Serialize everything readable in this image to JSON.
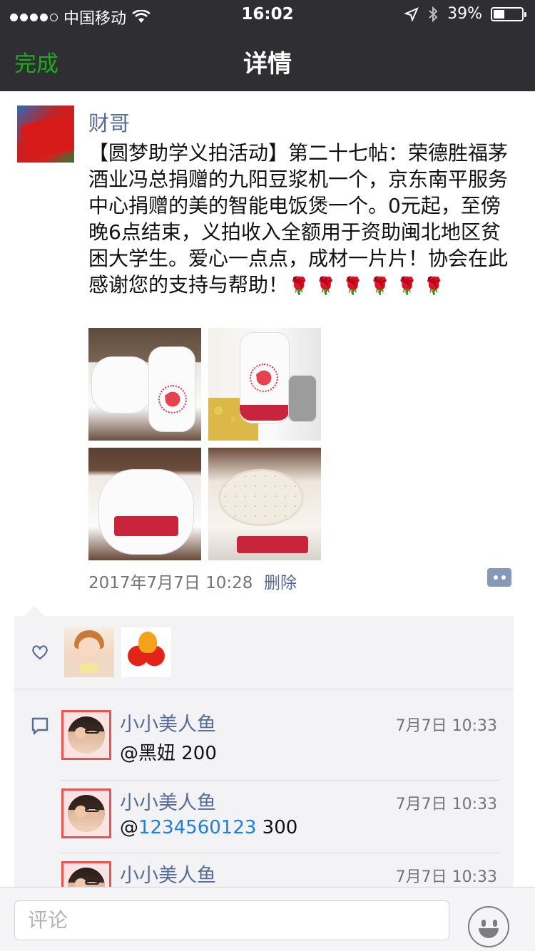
{
  "status_bar": {
    "carrier": "中国移动",
    "time": "16:02",
    "battery": "39%",
    "battery_level": 0.39
  },
  "nav": {
    "done_label": "完成",
    "title": "详情"
  },
  "post": {
    "author": "财哥",
    "content": "【圆梦助学义拍活动】第二十七帖：荣德胜福茅酒业冯总捐赠的九阳豆浆机一个，京东南平服务中心捐赠的美的智能电饭煲一个。0元起，至傍晚6点结束，义拍收入全额用于资助闽北地区贫困大学生。爱心一点点，成材一片片！协会在此感谢您的支持与帮助！",
    "emoji_roses": "🌹🌹🌹🌹🌹🌹",
    "timestamp": "2017年7月7日 10:28",
    "delete_label": "删除"
  },
  "comments": [
    {
      "name": "小小美人鱼",
      "time": "7月7日 10:33",
      "text_prefix": "@黑妞 200",
      "mention": "",
      "text_suffix": ""
    },
    {
      "name": "小小美人鱼",
      "time": "7月7日 10:33",
      "text_prefix": "@",
      "mention": "1234560123",
      "text_suffix": " 300"
    },
    {
      "name": "小小美人鱼",
      "time": "7月7日 10:33",
      "text_prefix": "",
      "mention": "",
      "text_suffix": ""
    }
  ],
  "input": {
    "placeholder": "评论"
  },
  "colors": {
    "accent_green": "#1aad19",
    "link_blue": "#576b95",
    "mention_blue": "#1a7fe8"
  }
}
